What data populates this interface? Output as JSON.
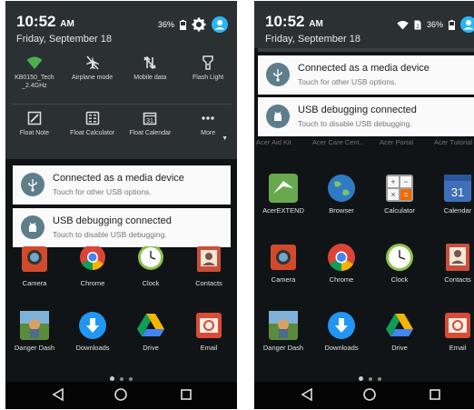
{
  "left": {
    "status": {
      "time": "10:52",
      "ampm": "AM",
      "date": "Friday, September 18",
      "battery": "36%"
    },
    "quick_settings": {
      "row1": [
        {
          "label": "KB0150_Tech _2.4GHz",
          "icon": "wifi-icon"
        },
        {
          "label": "Airplane mode",
          "icon": "airplane-icon"
        },
        {
          "label": "Mobile data",
          "icon": "mobile-data-icon"
        },
        {
          "label": "Flash Light",
          "icon": "flashlight-icon"
        }
      ],
      "row2": [
        {
          "label": "Float Note",
          "icon": "note-icon"
        },
        {
          "label": "Float Calculator",
          "icon": "calculator-icon"
        },
        {
          "label": "Float Calendar",
          "icon": "calendar-icon"
        },
        {
          "label": "More",
          "icon": "more-icon"
        }
      ]
    },
    "notifications": [
      {
        "title": "Connected as a media device",
        "subtitle": "Touch for other USB options."
      },
      {
        "title": "USB debugging connected",
        "subtitle": "Touch to disable USB debugging."
      }
    ],
    "apps": [
      {
        "label": "Camera"
      },
      {
        "label": "Chrome"
      },
      {
        "label": "Clock"
      },
      {
        "label": "Contacts"
      },
      {
        "label": "Danger Dash"
      },
      {
        "label": "Downloads"
      },
      {
        "label": "Drive"
      },
      {
        "label": "Email"
      }
    ]
  },
  "right": {
    "status": {
      "time": "10:52",
      "ampm": "AM",
      "date": "Friday, September 18",
      "battery": "36%"
    },
    "notifications": [
      {
        "title": "Connected as a media device",
        "subtitle": "Touch for other USB options."
      },
      {
        "title": "USB debugging connected",
        "subtitle": "Touch to disable USB debugging."
      }
    ],
    "partial_labels": [
      "Acer Aid Kit",
      "Acer Care Cent...",
      "Acer Portal",
      "Acer Tutorial"
    ],
    "apps": [
      {
        "label": "AcerEXTEND"
      },
      {
        "label": "Browser"
      },
      {
        "label": "Calculator"
      },
      {
        "label": "Calendar"
      },
      {
        "label": "Camera"
      },
      {
        "label": "Chrome"
      },
      {
        "label": "Clock"
      },
      {
        "label": "Contacts"
      },
      {
        "label": "Danger Dash"
      },
      {
        "label": "Downloads"
      },
      {
        "label": "Drive"
      },
      {
        "label": "Email"
      }
    ]
  },
  "colors": {
    "accent": "#29b6f6",
    "notif_icon_bg": "#5f7e8c",
    "shade_bg": "#2b3033",
    "home_bg": "#111416"
  }
}
